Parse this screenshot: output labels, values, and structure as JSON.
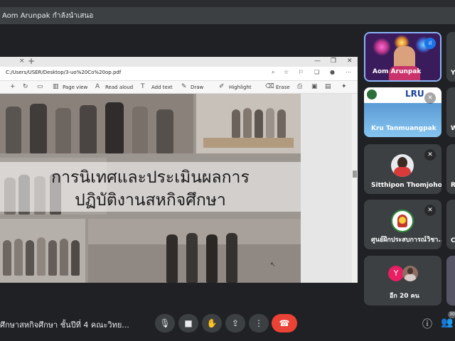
{
  "header": {
    "presenter_text": "Aom Arunpak กำลังนำเสนอ"
  },
  "browser": {
    "tab_close": "×",
    "tab_new": "+",
    "window_controls": [
      "—",
      "❐",
      "✕"
    ],
    "address": "C:/Users/USER/Desktop/3-uo%20Co%20op.pdf",
    "toolbar": {
      "page_view": "Page view",
      "read_aloud": "Read aloud",
      "add_text": "Add text",
      "draw": "Draw",
      "highlight": "Highlight",
      "erase": "Erase"
    }
  },
  "slide": {
    "title_line1": "การนิเทศและประเมินผลการ",
    "title_line2": "ปฏิบัติงานสหกิจศึกษา"
  },
  "participants": [
    {
      "name": "Aom Arunpak",
      "mic": "speaking"
    },
    {
      "name": "Kru Tanmuangpak",
      "mic": "muted",
      "banner_text": "LRU"
    },
    {
      "name": "Sitthipon Thomjoho",
      "mic": "muted"
    },
    {
      "name": "ศูนย์ฝึกประสบการณ์วิชา...",
      "mic": "muted"
    },
    {
      "name": "อีก 20 คน",
      "avatar_letter": "Y"
    }
  ],
  "right_partial_letters": [
    "Y",
    "W",
    "R",
    "C"
  ],
  "bottom": {
    "meeting_title": "ศึกษาสหกิจศึกษา ชั้นปีที่ 4 คณะวิทย...",
    "participant_count": "30"
  },
  "colors": {
    "background": "#202124",
    "tile": "#3c4043",
    "end_call": "#ea4335",
    "speaking": "#8ab4f8"
  }
}
